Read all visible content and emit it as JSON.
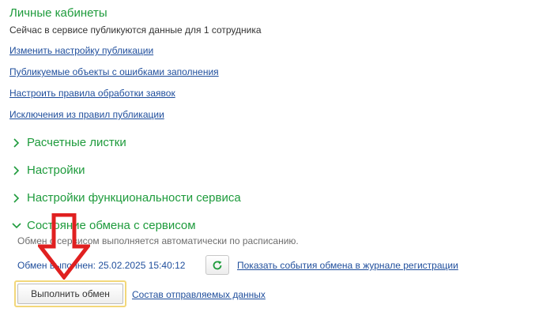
{
  "header": {
    "title": "Личные кабинеты",
    "info": "Сейчас в сервисе публикуются данные для 1 сотрудника"
  },
  "links": [
    "Изменить настройку публикации",
    "Публикуемые объекты с ошибками заполнения",
    "Настроить правила обработки заявок",
    "Исключения из правил публикации"
  ],
  "sections": [
    {
      "label": "Расчетные листки",
      "expanded": false
    },
    {
      "label": "Настройки",
      "expanded": false
    },
    {
      "label": "Настройки функциональности сервиса",
      "expanded": false
    },
    {
      "label": "Состояние обмена с сервисом",
      "expanded": true
    }
  ],
  "exchange": {
    "note": "Обмен с сервисом выполняется автоматически по расписанию.",
    "status_text": "Обмен выполнен: 25.02.2025 15:40:12",
    "refresh_icon": "refresh-icon",
    "events_link": "Показать события обмена в журнале регистрации",
    "run_button": "Выполнить обмен",
    "data_link": "Состав отправляемых данных"
  },
  "colors": {
    "green": "#1e9b3c",
    "link": "#1f4e9c",
    "annotation": "#e02020",
    "button_focus": "#f2d77a"
  }
}
